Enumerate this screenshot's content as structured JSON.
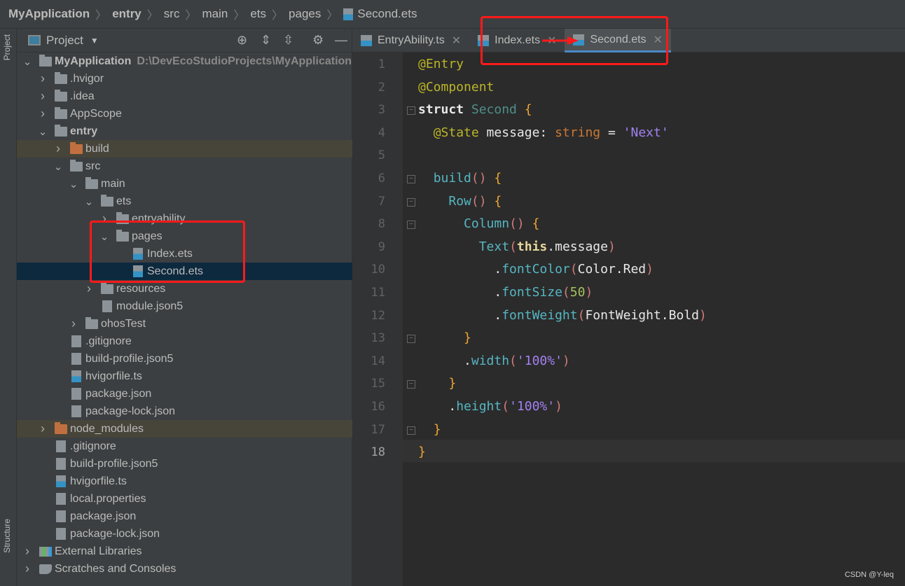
{
  "breadcrumb": [
    "MyApplication",
    "entry",
    "src",
    "main",
    "ets",
    "pages",
    "Second.ets"
  ],
  "side_tabs": {
    "project": "Project",
    "structure": "Structure"
  },
  "project_panel": {
    "title": "Project",
    "root_path": "D:\\DevEcoStudioProjects\\MyApplication",
    "tree": [
      {
        "label": "MyApplication",
        "level": 0,
        "kind": "module",
        "state": "expanded",
        "bold": true
      },
      {
        "label": ".hvigor",
        "level": 1,
        "kind": "folder",
        "state": "collapsed"
      },
      {
        "label": ".idea",
        "level": 1,
        "kind": "folder",
        "state": "collapsed"
      },
      {
        "label": "AppScope",
        "level": 1,
        "kind": "folder",
        "state": "collapsed"
      },
      {
        "label": "entry",
        "level": 1,
        "kind": "module",
        "state": "expanded",
        "bold": true
      },
      {
        "label": "build",
        "level": 2,
        "kind": "excluded-folder",
        "state": "collapsed",
        "highlight": true
      },
      {
        "label": "src",
        "level": 2,
        "kind": "folder",
        "state": "expanded"
      },
      {
        "label": "main",
        "level": 3,
        "kind": "folder",
        "state": "expanded"
      },
      {
        "label": "ets",
        "level": 4,
        "kind": "folder",
        "state": "expanded"
      },
      {
        "label": "entryability",
        "level": 5,
        "kind": "folder",
        "state": "collapsed"
      },
      {
        "label": "pages",
        "level": 5,
        "kind": "folder",
        "state": "expanded"
      },
      {
        "label": "Index.ets",
        "level": 6,
        "kind": "ets"
      },
      {
        "label": "Second.ets",
        "level": 6,
        "kind": "ets",
        "selected": true
      },
      {
        "label": "resources",
        "level": 4,
        "kind": "folder",
        "state": "collapsed"
      },
      {
        "label": "module.json5",
        "level": 4,
        "kind": "json"
      },
      {
        "label": "ohosTest",
        "level": 3,
        "kind": "folder",
        "state": "collapsed"
      },
      {
        "label": ".gitignore",
        "level": 2,
        "kind": "file"
      },
      {
        "label": "build-profile.json5",
        "level": 2,
        "kind": "json"
      },
      {
        "label": "hvigorfile.ts",
        "level": 2,
        "kind": "ts"
      },
      {
        "label": "package.json",
        "level": 2,
        "kind": "json"
      },
      {
        "label": "package-lock.json",
        "level": 2,
        "kind": "json"
      },
      {
        "label": "node_modules",
        "level": 1,
        "kind": "excluded-folder",
        "state": "collapsed",
        "highlight": true
      },
      {
        "label": ".gitignore",
        "level": 1,
        "kind": "file"
      },
      {
        "label": "build-profile.json5",
        "level": 1,
        "kind": "json"
      },
      {
        "label": "hvigorfile.ts",
        "level": 1,
        "kind": "ts"
      },
      {
        "label": "local.properties",
        "level": 1,
        "kind": "file"
      },
      {
        "label": "package.json",
        "level": 1,
        "kind": "json"
      },
      {
        "label": "package-lock.json",
        "level": 1,
        "kind": "json"
      },
      {
        "label": "External Libraries",
        "level": 0,
        "kind": "libraries",
        "state": "collapsed"
      },
      {
        "label": "Scratches and Consoles",
        "level": 0,
        "kind": "scratches",
        "state": "collapsed"
      }
    ]
  },
  "editor_tabs": [
    {
      "label": "EntryAbility.ts",
      "active": false
    },
    {
      "label": "Index.ets",
      "active": false
    },
    {
      "label": "Second.ets",
      "active": true
    }
  ],
  "code_colors": {
    "dec": "#bbb529",
    "kw": "#e8e8e8",
    "type": "#4e8f8a",
    "id": "#e8e8e8",
    "str": "#6a8759",
    "brace": "#f0a732",
    "paren": "#d07b7b",
    "fn": "#56b6c2",
    "num": "#a5c25c",
    "strv": "#a280f0",
    "typ": "#cc7832"
  },
  "code": [
    [
      [
        "dec",
        "@Entry"
      ]
    ],
    [
      [
        "dec",
        "@Component"
      ]
    ],
    [
      [
        "kw",
        "struct "
      ],
      [
        "type",
        "Second "
      ],
      [
        "brace",
        "{"
      ]
    ],
    [
      [
        "id",
        "  "
      ],
      [
        "dec",
        "@State"
      ],
      [
        "id",
        " message: "
      ],
      [
        "typ",
        "string"
      ],
      [
        "id",
        " = "
      ],
      [
        "strv",
        "'Next'"
      ]
    ],
    [],
    [
      [
        "id",
        "  "
      ],
      [
        "fn",
        "build"
      ],
      [
        "paren",
        "()"
      ],
      [
        "id",
        " "
      ],
      [
        "brace",
        "{"
      ]
    ],
    [
      [
        "id",
        "    "
      ],
      [
        "fn",
        "Row"
      ],
      [
        "paren",
        "()"
      ],
      [
        "id",
        " "
      ],
      [
        "brace",
        "{"
      ]
    ],
    [
      [
        "id",
        "      "
      ],
      [
        "fn",
        "Column"
      ],
      [
        "paren",
        "()"
      ],
      [
        "id",
        " "
      ],
      [
        "brace",
        "{"
      ]
    ],
    [
      [
        "id",
        "        "
      ],
      [
        "fn",
        "Text"
      ],
      [
        "paren",
        "("
      ],
      [
        "kw",
        "this"
      ],
      [
        "id",
        ".message"
      ],
      [
        "paren",
        ")"
      ]
    ],
    [
      [
        "id",
        "          ."
      ],
      [
        "fn",
        "fontColor"
      ],
      [
        "paren",
        "("
      ],
      [
        "id",
        "Color.Red"
      ],
      [
        "paren",
        ")"
      ]
    ],
    [
      [
        "id",
        "          ."
      ],
      [
        "fn",
        "fontSize"
      ],
      [
        "paren",
        "("
      ],
      [
        "num",
        "50"
      ],
      [
        "paren",
        ")"
      ]
    ],
    [
      [
        "id",
        "          ."
      ],
      [
        "fn",
        "fontWeight"
      ],
      [
        "paren",
        "("
      ],
      [
        "id",
        "FontWeight.Bold"
      ],
      [
        "paren",
        ")"
      ]
    ],
    [
      [
        "id",
        "      "
      ],
      [
        "brace",
        "}"
      ]
    ],
    [
      [
        "id",
        "      ."
      ],
      [
        "fn",
        "width"
      ],
      [
        "paren",
        "("
      ],
      [
        "strv",
        "'100%'"
      ],
      [
        "paren",
        ")"
      ]
    ],
    [
      [
        "id",
        "    "
      ],
      [
        "brace",
        "}"
      ]
    ],
    [
      [
        "id",
        "    ."
      ],
      [
        "fn",
        "height"
      ],
      [
        "paren",
        "("
      ],
      [
        "strv",
        "'100%'"
      ],
      [
        "paren",
        ")"
      ]
    ],
    [
      [
        "id",
        "  "
      ],
      [
        "brace",
        "}"
      ]
    ],
    [
      [
        "brace",
        "}"
      ]
    ]
  ],
  "current_line": 18,
  "watermark": "CSDN @Y-leq"
}
